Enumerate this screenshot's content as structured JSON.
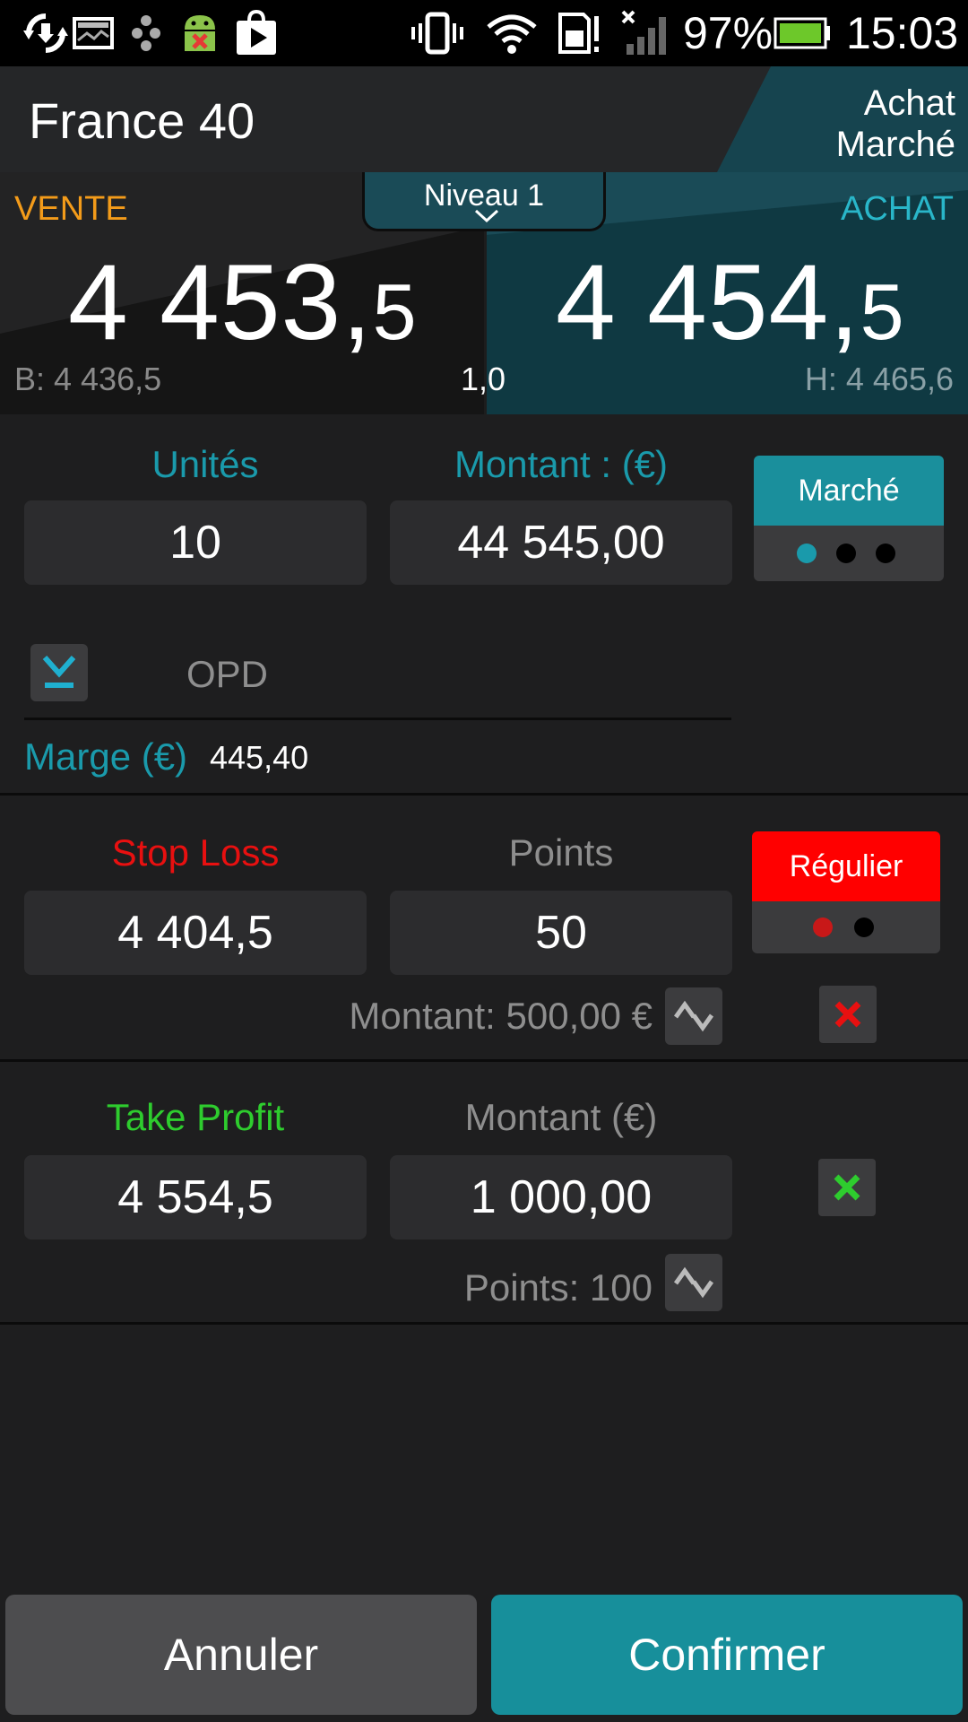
{
  "status_bar": {
    "battery": "97%",
    "time": "15:03"
  },
  "header": {
    "title": "France 40",
    "mode_line1": "Achat",
    "mode_line2": "Marché"
  },
  "prices": {
    "sell_label": "VENTE",
    "buy_label": "ACHAT",
    "level_tab": "Niveau 1",
    "sell_int": "4 453,",
    "sell_dec": "5",
    "buy_int": "4 454,",
    "buy_dec": "5",
    "low": "B: 4 436,5",
    "spread": "1,0",
    "high": "H: 4 465,6"
  },
  "order": {
    "units_label": "Unités",
    "units_value": "10",
    "amount_label": "Montant : (€)",
    "amount_value": "44 545,00",
    "type_label": "Marché",
    "opd_label": "OPD",
    "margin_label": "Marge (€)",
    "margin_value": "445,40"
  },
  "stop_loss": {
    "label": "Stop Loss",
    "value": "4 404,5",
    "points_label": "Points",
    "points_value": "50",
    "type_label": "Régulier",
    "amount_text": "Montant: 500,00 €"
  },
  "take_profit": {
    "label": "Take Profit",
    "value": "4 554,5",
    "amount_label": "Montant (€)",
    "amount_value": "1 000,00",
    "points_text": "Points: 100"
  },
  "actions": {
    "cancel": "Annuler",
    "confirm": "Confirmer"
  },
  "colors": {
    "accent_teal": "#1a8f9c",
    "sell_orange": "#f39b1a",
    "stop_red": "#e81010",
    "profit_green": "#2ecc2e"
  }
}
